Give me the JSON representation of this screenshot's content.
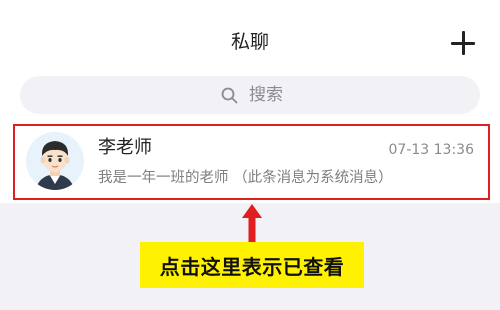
{
  "header": {
    "title": "私聊",
    "add_icon": "plus-icon"
  },
  "search": {
    "placeholder": "搜索",
    "icon": "search-icon"
  },
  "chats": [
    {
      "name": "李老师",
      "time": "07-13 13:36",
      "preview": "我是一年一班的老师 （此条消息为系统消息）",
      "avatar": "boy-avatar"
    }
  ],
  "annotation": {
    "text": "点击这里表示已查看",
    "highlight_color": "#e02020",
    "callout_bg": "#fff200"
  }
}
